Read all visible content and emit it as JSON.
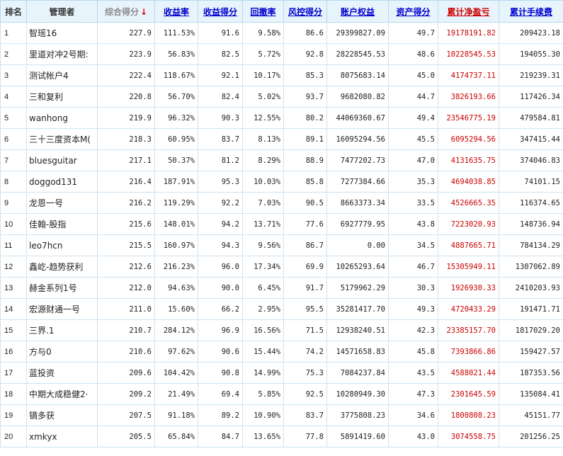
{
  "headers": {
    "rank": "排名",
    "manager": "管理者",
    "composite": "综合得分",
    "composite_sort": "↓",
    "return_rate": "收益率",
    "return_score": "收益得分",
    "drawdown": "回撤率",
    "risk_score": "风控得分",
    "equity": "账户权益",
    "asset_score": "资产得分",
    "net_pnl": "累计净盈亏",
    "fees": "累计手续费"
  },
  "colors": {
    "header_bg": "#e8f4fc",
    "border": "#cfe3f2",
    "link": "#0000cc",
    "profit_red": "#cc0000",
    "sort_arrow": "#e00000"
  },
  "rows": [
    {
      "rank": "1",
      "manager": "智瑶16",
      "composite": "227.9",
      "return_rate": "111.53%",
      "return_score": "91.6",
      "drawdown": "9.58%",
      "risk_score": "86.6",
      "equity": "29399827.09",
      "asset_score": "49.7",
      "net_pnl": "19178191.82",
      "fees": "209423.18"
    },
    {
      "rank": "2",
      "manager": "里道对冲2号期:",
      "composite": "223.9",
      "return_rate": "56.83%",
      "return_score": "82.5",
      "drawdown": "5.72%",
      "risk_score": "92.8",
      "equity": "28228545.53",
      "asset_score": "48.6",
      "net_pnl": "10228545.53",
      "fees": "194055.30"
    },
    {
      "rank": "3",
      "manager": "测试帐户4",
      "composite": "222.4",
      "return_rate": "118.67%",
      "return_score": "92.1",
      "drawdown": "10.17%",
      "risk_score": "85.3",
      "equity": "8075683.14",
      "asset_score": "45.0",
      "net_pnl": "4174737.11",
      "fees": "219239.31"
    },
    {
      "rank": "4",
      "manager": "三和复利",
      "composite": "220.8",
      "return_rate": "56.70%",
      "return_score": "82.4",
      "drawdown": "5.02%",
      "risk_score": "93.7",
      "equity": "9682080.82",
      "asset_score": "44.7",
      "net_pnl": "3826193.66",
      "fees": "117426.34"
    },
    {
      "rank": "5",
      "manager": "wanhong",
      "composite": "219.9",
      "return_rate": "96.32%",
      "return_score": "90.3",
      "drawdown": "12.55%",
      "risk_score": "80.2",
      "equity": "44069360.67",
      "asset_score": "49.4",
      "net_pnl": "23546775.19",
      "fees": "479584.81"
    },
    {
      "rank": "6",
      "manager": "三十三度资本M(",
      "composite": "218.3",
      "return_rate": "60.95%",
      "return_score": "83.7",
      "drawdown": "8.13%",
      "risk_score": "89.1",
      "equity": "16095294.56",
      "asset_score": "45.5",
      "net_pnl": "6095294.56",
      "fees": "347415.44"
    },
    {
      "rank": "7",
      "manager": "bluesguitar",
      "composite": "217.1",
      "return_rate": "50.37%",
      "return_score": "81.2",
      "drawdown": "8.29%",
      "risk_score": "88.9",
      "equity": "7477202.73",
      "asset_score": "47.0",
      "net_pnl": "4131635.75",
      "fees": "374046.83"
    },
    {
      "rank": "8",
      "manager": "doggod131",
      "composite": "216.4",
      "return_rate": "187.91%",
      "return_score": "95.3",
      "drawdown": "10.03%",
      "risk_score": "85.8",
      "equity": "7277384.66",
      "asset_score": "35.3",
      "net_pnl": "4694038.85",
      "fees": "74101.15"
    },
    {
      "rank": "9",
      "manager": "龙恩一号",
      "composite": "216.2",
      "return_rate": "119.29%",
      "return_score": "92.2",
      "drawdown": "7.03%",
      "risk_score": "90.5",
      "equity": "8663373.34",
      "asset_score": "33.5",
      "net_pnl": "4526665.35",
      "fees": "116374.65"
    },
    {
      "rank": "10",
      "manager": "佳翰-股指",
      "composite": "215.6",
      "return_rate": "148.01%",
      "return_score": "94.2",
      "drawdown": "13.71%",
      "risk_score": "77.6",
      "equity": "6927779.95",
      "asset_score": "43.8",
      "net_pnl": "7223020.93",
      "fees": "148736.94"
    },
    {
      "rank": "11",
      "manager": "leo7hcn",
      "composite": "215.5",
      "return_rate": "160.97%",
      "return_score": "94.3",
      "drawdown": "9.56%",
      "risk_score": "86.7",
      "equity": "0.00",
      "asset_score": "34.5",
      "net_pnl": "4887665.71",
      "fees": "784134.29"
    },
    {
      "rank": "12",
      "manager": "鑫屹-趋势获利",
      "composite": "212.6",
      "return_rate": "216.23%",
      "return_score": "96.0",
      "drawdown": "17.34%",
      "risk_score": "69.9",
      "equity": "10265293.64",
      "asset_score": "46.7",
      "net_pnl": "15305949.11",
      "fees": "1307062.89"
    },
    {
      "rank": "13",
      "manager": "赫金系列1号",
      "composite": "212.0",
      "return_rate": "94.63%",
      "return_score": "90.0",
      "drawdown": "6.45%",
      "risk_score": "91.7",
      "equity": "5179962.29",
      "asset_score": "30.3",
      "net_pnl": "1926930.33",
      "fees": "2410203.93"
    },
    {
      "rank": "14",
      "manager": "宏源财通一号",
      "composite": "211.0",
      "return_rate": "15.60%",
      "return_score": "66.2",
      "drawdown": "2.95%",
      "risk_score": "95.5",
      "equity": "35281417.70",
      "asset_score": "49.3",
      "net_pnl": "4720433.29",
      "fees": "191471.71"
    },
    {
      "rank": "15",
      "manager": "三界.1",
      "composite": "210.7",
      "return_rate": "284.12%",
      "return_score": "96.9",
      "drawdown": "16.56%",
      "risk_score": "71.5",
      "equity": "12938240.51",
      "asset_score": "42.3",
      "net_pnl": "23385157.70",
      "fees": "1817029.20"
    },
    {
      "rank": "16",
      "manager": "方与0",
      "composite": "210.6",
      "return_rate": "97.62%",
      "return_score": "90.6",
      "drawdown": "15.44%",
      "risk_score": "74.2",
      "equity": "14571658.83",
      "asset_score": "45.8",
      "net_pnl": "7393866.86",
      "fees": "159427.57"
    },
    {
      "rank": "17",
      "manager": "蓝投资",
      "composite": "209.6",
      "return_rate": "104.42%",
      "return_score": "90.8",
      "drawdown": "14.99%",
      "risk_score": "75.3",
      "equity": "7084237.84",
      "asset_score": "43.5",
      "net_pnl": "4588021.44",
      "fees": "187353.56"
    },
    {
      "rank": "18",
      "manager": "中期大成稳健2·",
      "composite": "209.2",
      "return_rate": "21.49%",
      "return_score": "69.4",
      "drawdown": "5.85%",
      "risk_score": "92.5",
      "equity": "10280949.30",
      "asset_score": "47.3",
      "net_pnl": "2301645.59",
      "fees": "135084.41"
    },
    {
      "rank": "19",
      "manager": "镝多获",
      "composite": "207.5",
      "return_rate": "91.18%",
      "return_score": "89.2",
      "drawdown": "10.90%",
      "risk_score": "83.7",
      "equity": "3775808.23",
      "asset_score": "34.6",
      "net_pnl": "1800808.23",
      "fees": "45151.77"
    },
    {
      "rank": "20",
      "manager": "xmkyx",
      "composite": "205.5",
      "return_rate": "65.84%",
      "return_score": "84.7",
      "drawdown": "13.65%",
      "risk_score": "77.8",
      "equity": "5891419.60",
      "asset_score": "43.0",
      "net_pnl": "3074558.75",
      "fees": "201256.25"
    }
  ]
}
